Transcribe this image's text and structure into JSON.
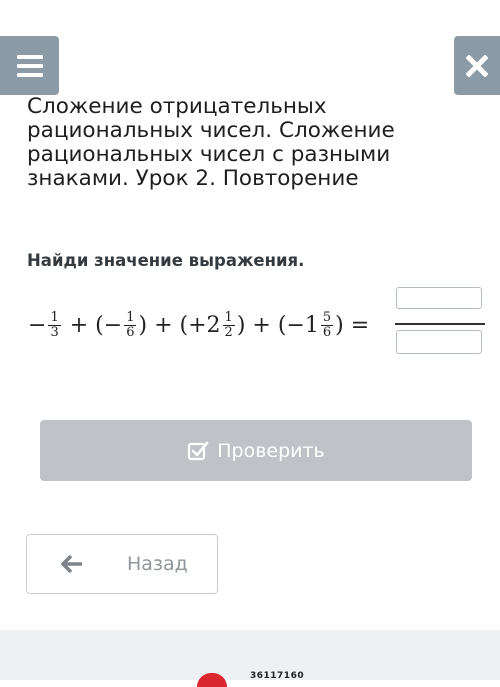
{
  "header": {
    "menu_icon": "hamburger-menu-icon",
    "close_icon": "close-x-icon",
    "accent_color": "#8c9aa5"
  },
  "lesson": {
    "title": "Сложение отрицательных рациональных чисел. Сложение рациональных чисел с разными знаками. Урок 2. Повторение",
    "task": "Найди значение выражения."
  },
  "expression": {
    "minus": "−",
    "plus": "+",
    "lparen": "(",
    "rparen": ")",
    "equals": "=",
    "terms": [
      {
        "sign": "",
        "whole": "",
        "num": "1",
        "den": "3"
      },
      {
        "sign": "−",
        "whole": "",
        "num": "1",
        "den": "6"
      },
      {
        "sign": "+",
        "whole": "2",
        "num": "1",
        "den": "2"
      },
      {
        "sign": "−",
        "whole": "1",
        "num": "5",
        "den": "6"
      }
    ]
  },
  "answer": {
    "numerator_value": "",
    "denominator_value": ""
  },
  "buttons": {
    "check_label": "Проверить",
    "check_icon": "check-square-icon",
    "back_label": "Назад",
    "back_icon": "arrow-left-icon"
  },
  "footer": {
    "code": "36117160"
  }
}
